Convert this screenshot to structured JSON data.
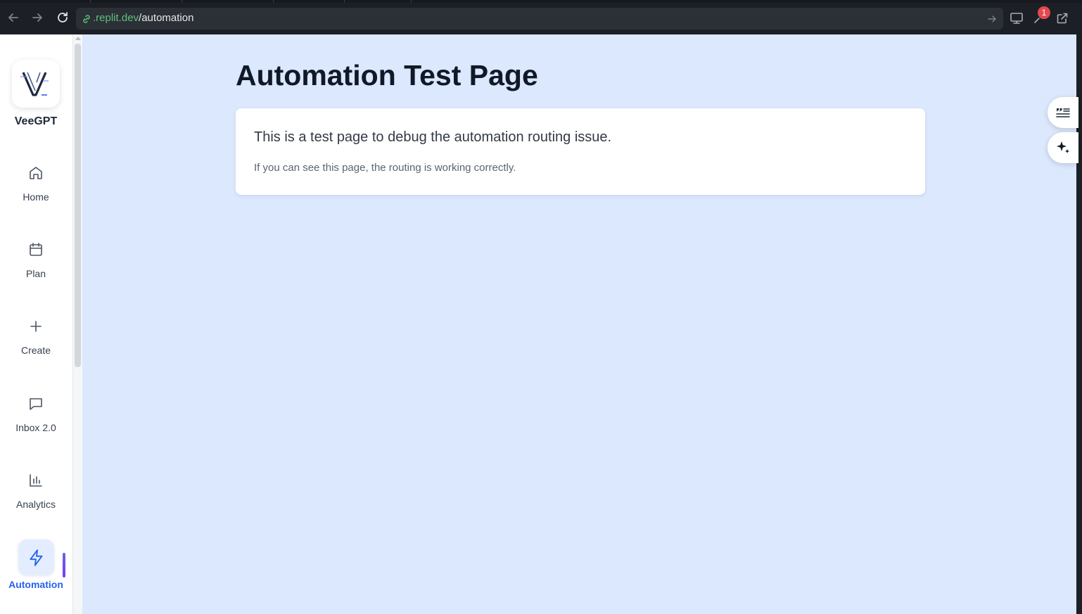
{
  "browser": {
    "url_domain": ".replit.dev",
    "url_path": "/automation",
    "notification_count": "1"
  },
  "sidebar": {
    "brand": "VeeGPT",
    "items": [
      {
        "label": "Home",
        "icon": "home-icon"
      },
      {
        "label": "Plan",
        "icon": "calendar-icon"
      },
      {
        "label": "Create",
        "icon": "plus-icon"
      },
      {
        "label": "Inbox 2.0",
        "icon": "chat-icon"
      },
      {
        "label": "Analytics",
        "icon": "bar-chart-icon"
      },
      {
        "label": "Automation",
        "icon": "lightning-icon",
        "active": true
      }
    ]
  },
  "main": {
    "title": "Automation Test Page",
    "card": {
      "heading": "This is a test page to debug the automation routing issue.",
      "subtext": "If you can see this page, the routing is working correctly."
    }
  },
  "colors": {
    "accent": "#2563eb",
    "content_bg": "#dbe8fd",
    "domain_green": "#5cc27a",
    "badge_red": "#e5484d"
  }
}
